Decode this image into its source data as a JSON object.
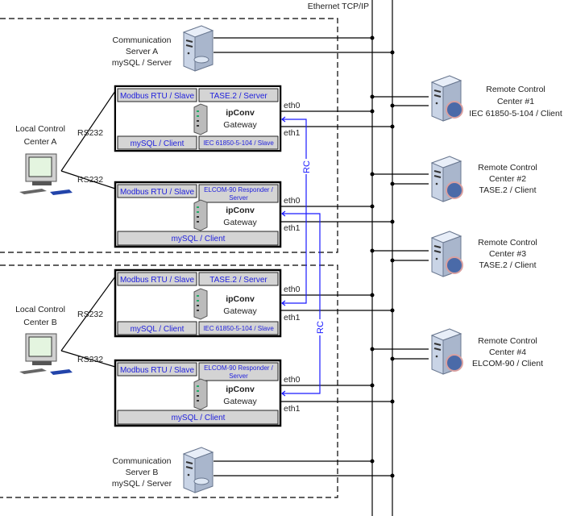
{
  "bus_label": "Ethernet TCP/IP",
  "comm_servers": [
    {
      "lines": [
        "Communication",
        "Server A",
        "mySQL / Server"
      ]
    },
    {
      "lines": [
        "Communication",
        "Server B",
        "mySQL / Server"
      ]
    }
  ],
  "local_centers": [
    {
      "lines": [
        "Local Control",
        "Center A"
      ],
      "link_labels": [
        "RS232",
        "RS232"
      ]
    },
    {
      "lines": [
        "Local Control",
        "Center B"
      ],
      "link_labels": [
        "RS232",
        "RS232"
      ]
    }
  ],
  "gateways": [
    {
      "name": "ipConv",
      "subtitle": "Gateway",
      "top_left": "Modbus RTU / Slave",
      "top_right": "TASE.2 / Server",
      "bottom_left": "mySQL / Client",
      "bottom_right": "IEC 61850-5-104 / Slave",
      "eth0": "eth0",
      "eth1": "eth1"
    },
    {
      "name": "ipConv",
      "subtitle": "Gateway",
      "top_left": "Modbus RTU / Slave",
      "top_right_lines": [
        "ELCOM-90 Responder /",
        "Server"
      ],
      "bottom": "mySQL / Client",
      "eth0": "eth0",
      "eth1": "eth1"
    },
    {
      "name": "ipConv",
      "subtitle": "Gateway",
      "top_left": "Modbus RTU / Slave",
      "top_right": "TASE.2 / Server",
      "bottom_left": "mySQL / Client",
      "bottom_right": "IEC 61850-5-104 / Slave",
      "eth0": "eth0",
      "eth1": "eth1"
    },
    {
      "name": "ipConv",
      "subtitle": "Gateway",
      "top_left": "Modbus RTU / Slave",
      "top_right_lines": [
        "ELCOM-90 Responder /",
        "Server"
      ],
      "bottom": "mySQL / Client",
      "eth0": "eth0",
      "eth1": "eth1"
    }
  ],
  "rc_links": [
    "RC",
    "RC"
  ],
  "remote_centers": [
    {
      "lines": [
        "Remote Control",
        "Center #1",
        "IEC 61850-5-104 / Client"
      ]
    },
    {
      "lines": [
        "Remote Control",
        "Center #2",
        "TASE.2 / Client"
      ]
    },
    {
      "lines": [
        "Remote Control",
        "Center #3",
        "TASE.2 / Client"
      ]
    },
    {
      "lines": [
        "Remote Control",
        "Center #4",
        "ELCOM-90 / Client"
      ]
    }
  ],
  "colors": {
    "protocol_text": "#2222dd",
    "rc_link": "#1a1aff",
    "cell_fill": "#d4d4d4"
  }
}
